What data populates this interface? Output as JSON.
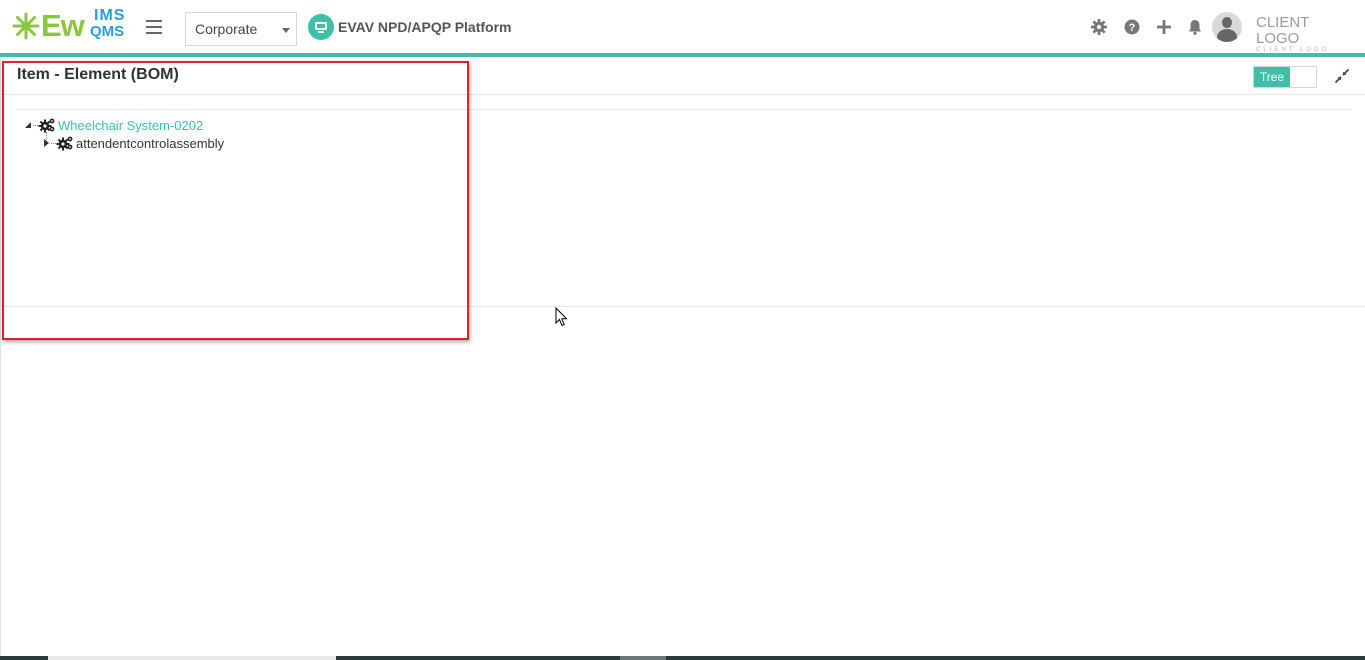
{
  "header": {
    "logo": {
      "brand_main": "Ew",
      "brand_top": "IMS",
      "brand_bottom": "QMS"
    },
    "menu_icon": "hamburger-icon",
    "org_select": {
      "value": "Corporate"
    },
    "platform": {
      "icon": "monitor-icon",
      "label": "EVAV NPD/APQP Platform"
    },
    "actions": [
      {
        "icon": "gear-icon"
      },
      {
        "icon": "question-circle-icon"
      },
      {
        "icon": "plus-icon"
      },
      {
        "icon": "bell-icon"
      }
    ],
    "client_logo": {
      "main": "CLIENT LOGO",
      "sub": "CLIENT LOGO"
    },
    "accent_color": "#3dbfa8"
  },
  "panel": {
    "title": "Item - Element (BOM)",
    "view_toggle": {
      "label": "Tree",
      "state": "on"
    },
    "collapse_icon": "compress-icon",
    "tree": [
      {
        "label": "Wheelchair System-0202",
        "icon": "gears-icon",
        "expanded": true,
        "children": [
          {
            "label": "attendentcontrolassembly",
            "icon": "gears-icon",
            "expanded": false
          }
        ]
      }
    ]
  },
  "colors": {
    "highlight_border": "#d9232e",
    "teal": "#3dbfa8"
  }
}
